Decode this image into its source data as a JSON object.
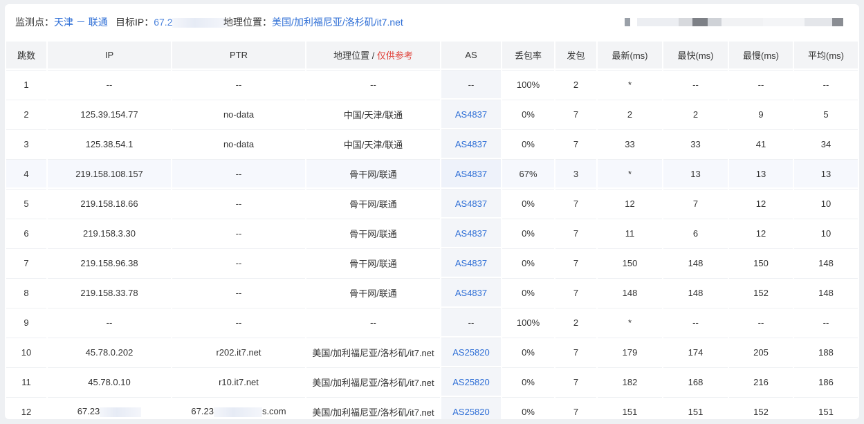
{
  "info": {
    "monitor_label": "监测点：",
    "monitor_value": "天津 － 联通",
    "target_label": "目标IP：",
    "target_value": "67.2",
    "geo_label": "地理位置：",
    "geo_value": "美国/加利福尼亚/洛杉矶/it7.net"
  },
  "columns": {
    "hop": "跳数",
    "ip": "IP",
    "ptr": "PTR",
    "geo": "地理位置",
    "geo_sep": " / ",
    "geo_note": "仅供参考",
    "as": "AS",
    "loss": "丢包率",
    "sent": "发包",
    "latest": "最新(ms)",
    "best": "最快(ms)",
    "worst": "最慢(ms)",
    "avg": "平均(ms)"
  },
  "rows": [
    {
      "hop": "1",
      "ip": "--",
      "ptr": "--",
      "geo": "--",
      "as": "--",
      "loss": "100%",
      "sent": "2",
      "latest": "*",
      "best": "--",
      "worst": "--",
      "avg": "--"
    },
    {
      "hop": "2",
      "ip": "125.39.154.77",
      "ptr": "no-data",
      "geo": "中国/天津/联通",
      "as": "AS4837",
      "loss": "0%",
      "sent": "7",
      "latest": "2",
      "best": "2",
      "worst": "9",
      "avg": "5"
    },
    {
      "hop": "3",
      "ip": "125.38.54.1",
      "ptr": "no-data",
      "geo": "中国/天津/联通",
      "as": "AS4837",
      "loss": "0%",
      "sent": "7",
      "latest": "33",
      "best": "33",
      "worst": "41",
      "avg": "34"
    },
    {
      "hop": "4",
      "ip": "219.158.108.157",
      "ptr": "--",
      "geo": "骨干网/联通",
      "as": "AS4837",
      "loss": "67%",
      "sent": "3",
      "latest": "*",
      "best": "13",
      "worst": "13",
      "avg": "13",
      "highlight": true
    },
    {
      "hop": "5",
      "ip": "219.158.18.66",
      "ptr": "--",
      "geo": "骨干网/联通",
      "as": "AS4837",
      "loss": "0%",
      "sent": "7",
      "latest": "12",
      "best": "7",
      "worst": "12",
      "avg": "10"
    },
    {
      "hop": "6",
      "ip": "219.158.3.30",
      "ptr": "--",
      "geo": "骨干网/联通",
      "as": "AS4837",
      "loss": "0%",
      "sent": "7",
      "latest": "11",
      "best": "6",
      "worst": "12",
      "avg": "10"
    },
    {
      "hop": "7",
      "ip": "219.158.96.38",
      "ptr": "--",
      "geo": "骨干网/联通",
      "as": "AS4837",
      "loss": "0%",
      "sent": "7",
      "latest": "150",
      "best": "148",
      "worst": "150",
      "avg": "148"
    },
    {
      "hop": "8",
      "ip": "219.158.33.78",
      "ptr": "--",
      "geo": "骨干网/联通",
      "as": "AS4837",
      "loss": "0%",
      "sent": "7",
      "latest": "148",
      "best": "148",
      "worst": "152",
      "avg": "148"
    },
    {
      "hop": "9",
      "ip": "--",
      "ptr": "--",
      "geo": "--",
      "as": "--",
      "loss": "100%",
      "sent": "2",
      "latest": "*",
      "best": "--",
      "worst": "--",
      "avg": "--"
    },
    {
      "hop": "10",
      "ip": "45.78.0.202",
      "ptr": "r202.it7.net",
      "geo": "美国/加利福尼亚/洛杉矶/it7.net",
      "as": "AS25820",
      "loss": "0%",
      "sent": "7",
      "latest": "179",
      "best": "174",
      "worst": "205",
      "avg": "188"
    },
    {
      "hop": "11",
      "ip": "45.78.0.10",
      "ptr": "r10.it7.net",
      "geo": "美国/加利福尼亚/洛杉矶/it7.net",
      "as": "AS25820",
      "loss": "0%",
      "sent": "7",
      "latest": "182",
      "best": "168",
      "worst": "216",
      "avg": "186"
    },
    {
      "hop": "12",
      "ip": "67.23",
      "ptr": "67.23",
      "ptr_tail": "s.com",
      "geo": "美国/加利福尼亚/洛杉矶/it7.net",
      "as": "AS25820",
      "loss": "0%",
      "sent": "7",
      "latest": "151",
      "best": "151",
      "worst": "152",
      "avg": "151"
    }
  ]
}
